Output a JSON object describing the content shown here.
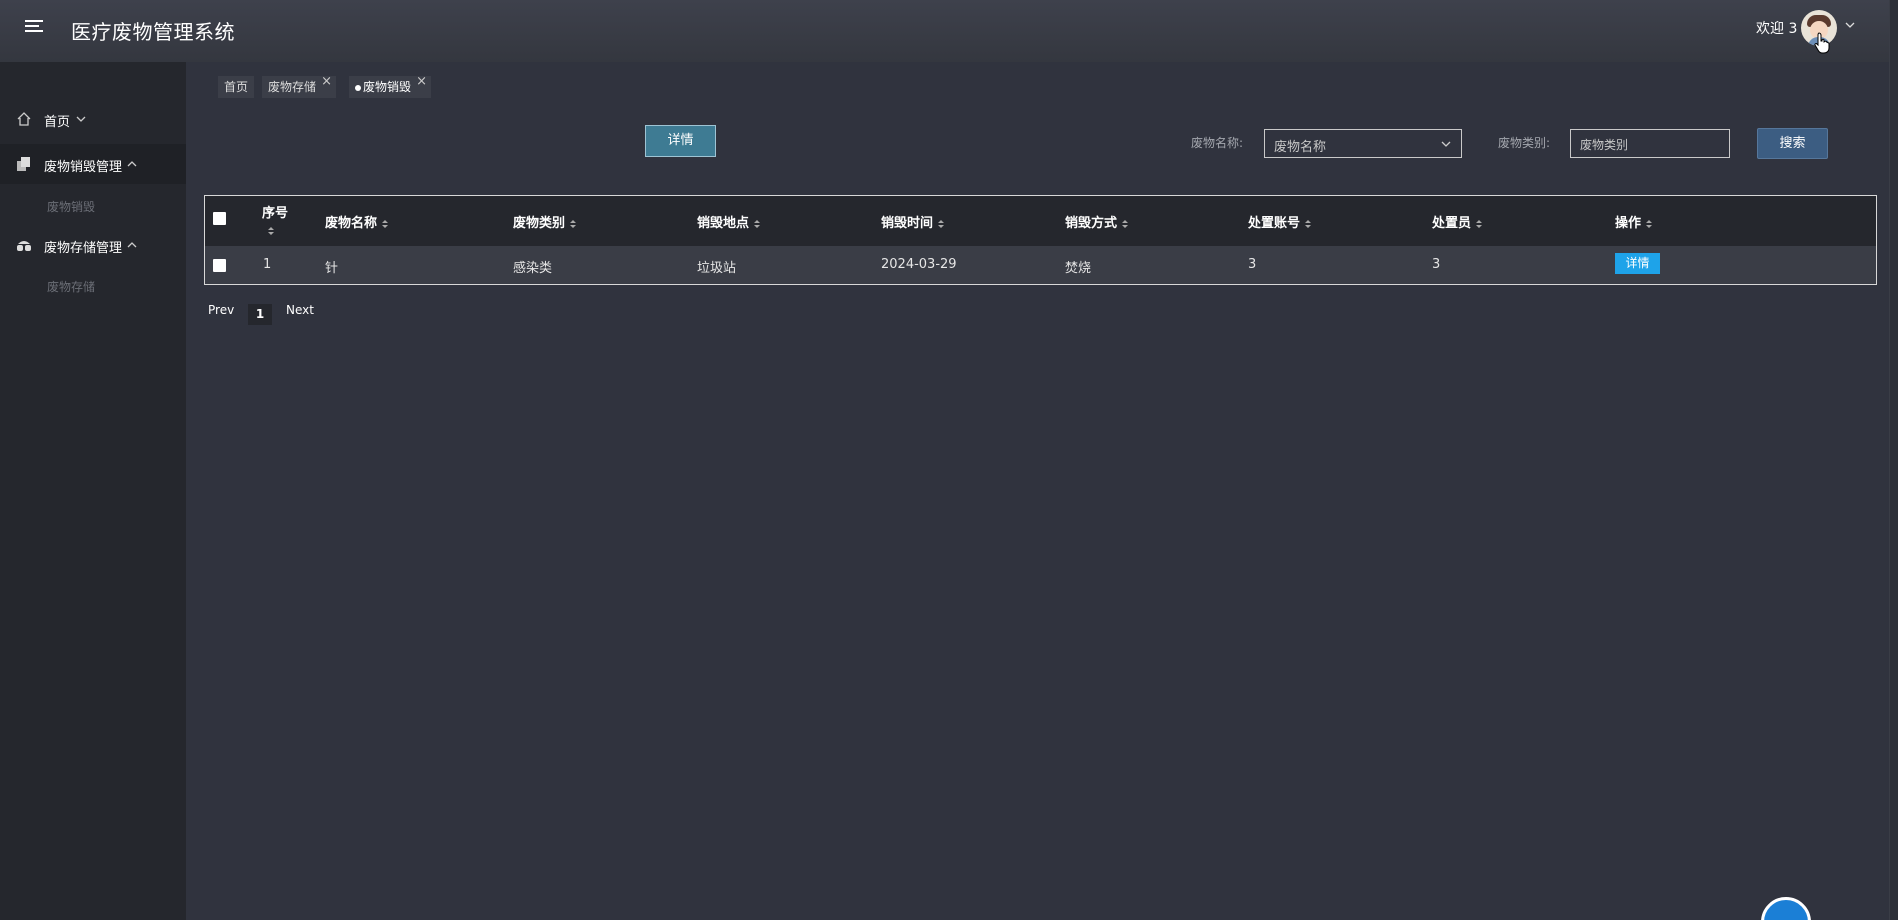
{
  "header": {
    "app_title": "医疗废物管理系统",
    "welcome_text": "欢迎 3",
    "menu_icon": "hamburger-icon",
    "avatar_icon": "user-avatar",
    "user_menu_icon": "chevron-down-icon"
  },
  "sidebar": {
    "items": [
      {
        "label": "首页",
        "icon": "home-icon",
        "expand_icon": "chevron-down-icon"
      },
      {
        "label": "废物销毁管理",
        "icon": "documents-icon",
        "expand_icon": "chevron-up-icon",
        "children": [
          "废物销毁"
        ]
      },
      {
        "label": "废物存储管理",
        "icon": "storage-icon",
        "expand_icon": "chevron-up-icon",
        "children": [
          "废物存储"
        ]
      }
    ]
  },
  "tabs": [
    {
      "label": "首页",
      "closable": false
    },
    {
      "label": "废物存储",
      "closable": true
    },
    {
      "label": "废物销毁",
      "closable": true,
      "current": true
    }
  ],
  "toolbar": {
    "detail_button": "详情",
    "name_label": "废物名称:",
    "name_select_value": "废物名称",
    "category_label": "废物类别:",
    "category_placeholder": "废物类别",
    "search_button": "搜索"
  },
  "table": {
    "columns": [
      "序号",
      "废物名称",
      "废物类别",
      "销毁地点",
      "销毁时间",
      "销毁方式",
      "处置账号",
      "处置员",
      "操作"
    ],
    "rows": [
      {
        "index": "1",
        "name": "针",
        "category": "感染类",
        "location": "垃圾站",
        "time": "2024-03-29",
        "method": "焚烧",
        "account": "3",
        "operator": "3",
        "action": "详情"
      }
    ]
  },
  "pagination": {
    "prev": "Prev",
    "current_page": "1",
    "next": "Next"
  },
  "colors": {
    "accent_blue": "#1ea3e9",
    "search_button": "#3c5d82",
    "background": "#30333e",
    "sidebar": "#25272d"
  }
}
